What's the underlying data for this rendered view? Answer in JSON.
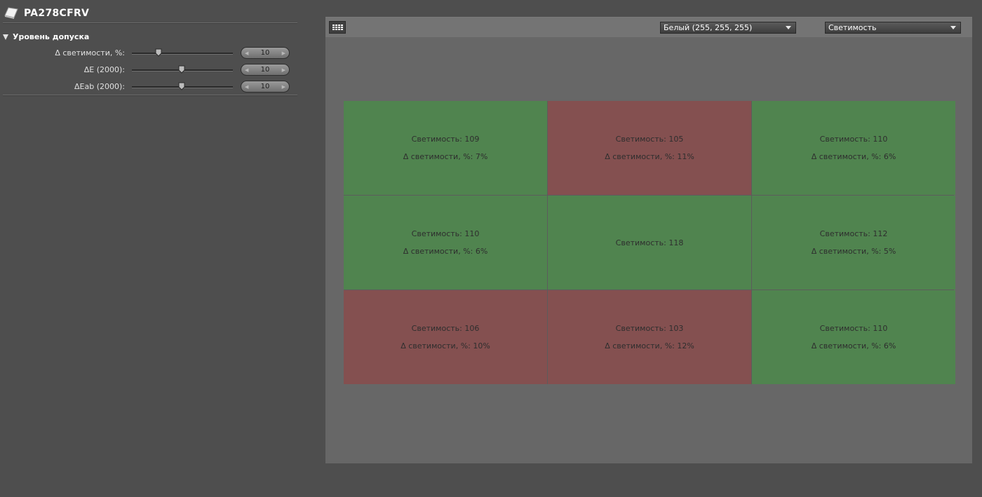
{
  "device": {
    "title": "PA278CFRV",
    "icon": "monitor-device-icon"
  },
  "tolerance": {
    "title": "Уровень допуска",
    "rows": [
      {
        "label": "Δ светимости, %:",
        "value": "10",
        "slider_level": 0.27
      },
      {
        "label": "ΔE (2000):",
        "value": "10",
        "slider_level": 0.5
      },
      {
        "label": "ΔEab (2000):",
        "value": "10",
        "slider_level": 0.5
      }
    ]
  },
  "toolbar": {
    "grid_icon": "grid-layout-icon",
    "color_select": "Белый (255, 255, 255)",
    "metric_select": "Светимость"
  },
  "colors": {
    "pass": "#50844f",
    "fail": "#845050"
  },
  "cells": [
    {
      "status": "pass",
      "luminance_label": "Светимость:  109",
      "delta_label": "Δ светимости, %:  7%"
    },
    {
      "status": "fail",
      "luminance_label": "Светимость:  105",
      "delta_label": "Δ светимости, %:  11%"
    },
    {
      "status": "pass",
      "luminance_label": "Светимость:  110",
      "delta_label": "Δ светимости, %:  6%"
    },
    {
      "status": "pass",
      "luminance_label": "Светимость:  110",
      "delta_label": "Δ светимости, %:  6%"
    },
    {
      "status": "pass",
      "luminance_label": "Светимость:  118",
      "delta_label": ""
    },
    {
      "status": "pass",
      "luminance_label": "Светимость:  112",
      "delta_label": "Δ светимости, %:  5%"
    },
    {
      "status": "fail",
      "luminance_label": "Светимость:  106",
      "delta_label": "Δ светимости, %:  10%"
    },
    {
      "status": "fail",
      "luminance_label": "Светимость:  103",
      "delta_label": "Δ светимости, %:  12%"
    },
    {
      "status": "pass",
      "luminance_label": "Светимость:  110",
      "delta_label": "Δ светимости, %:  6%"
    }
  ]
}
